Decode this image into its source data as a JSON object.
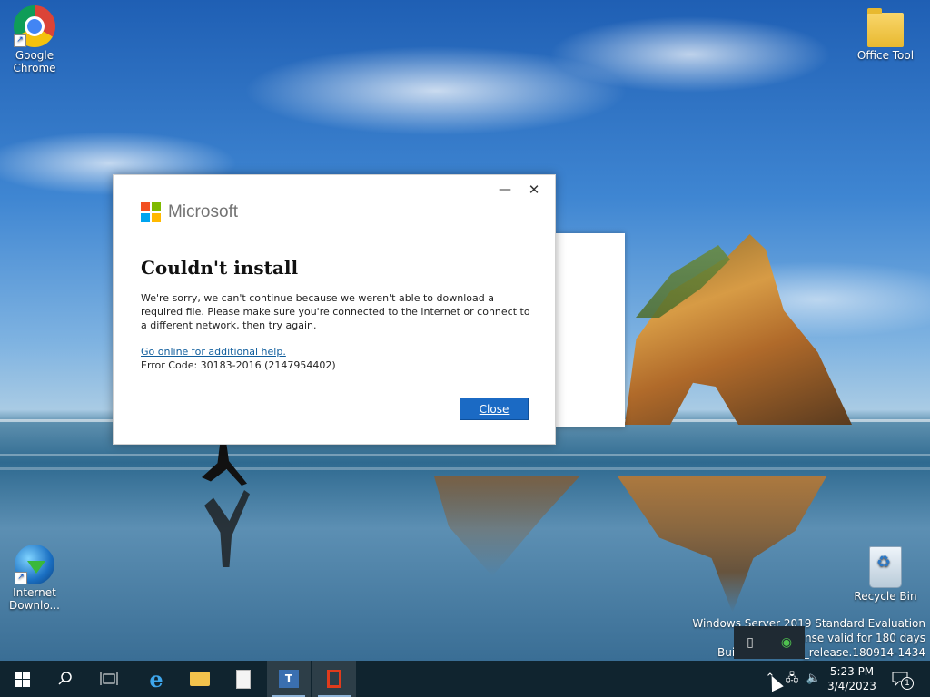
{
  "desktop": {
    "icons": {
      "chrome": "Google Chrome",
      "office_tool": "Office Tool",
      "idm": "Internet Downlo...",
      "recycle_bin": "Recycle Bin"
    },
    "watermark": {
      "line1": "Windows Server 2019 Standard Evaluation",
      "line2": "License valid for 180 days",
      "line3": "Build 17763.rs5_release.180914-1434"
    }
  },
  "dialog": {
    "brand": "Microsoft",
    "title": "Couldn't install",
    "message": "We're sorry, we can't continue because we weren't able to download a required file.  Please make sure you're connected to the internet or connect to a different network, then try again.",
    "help_link": "Go online for additional help.",
    "error_code": "Error Code: 30183-2016 (2147954402)",
    "close_label": "Close",
    "minimize_glyph": "—",
    "close_glyph": "✕",
    "logo_colors": [
      "#f25022",
      "#7fba00",
      "#00a4ef",
      "#ffb900"
    ]
  },
  "taskbar": {
    "clock_time": "5:23 PM",
    "clock_date": "3/4/2023",
    "notification_count": "1",
    "icons": [
      "start-icon",
      "search-icon",
      "task-view-icon",
      "internet-explorer-icon",
      "file-explorer-icon",
      "notepad-icon",
      "teams-icon",
      "office-icon"
    ]
  }
}
